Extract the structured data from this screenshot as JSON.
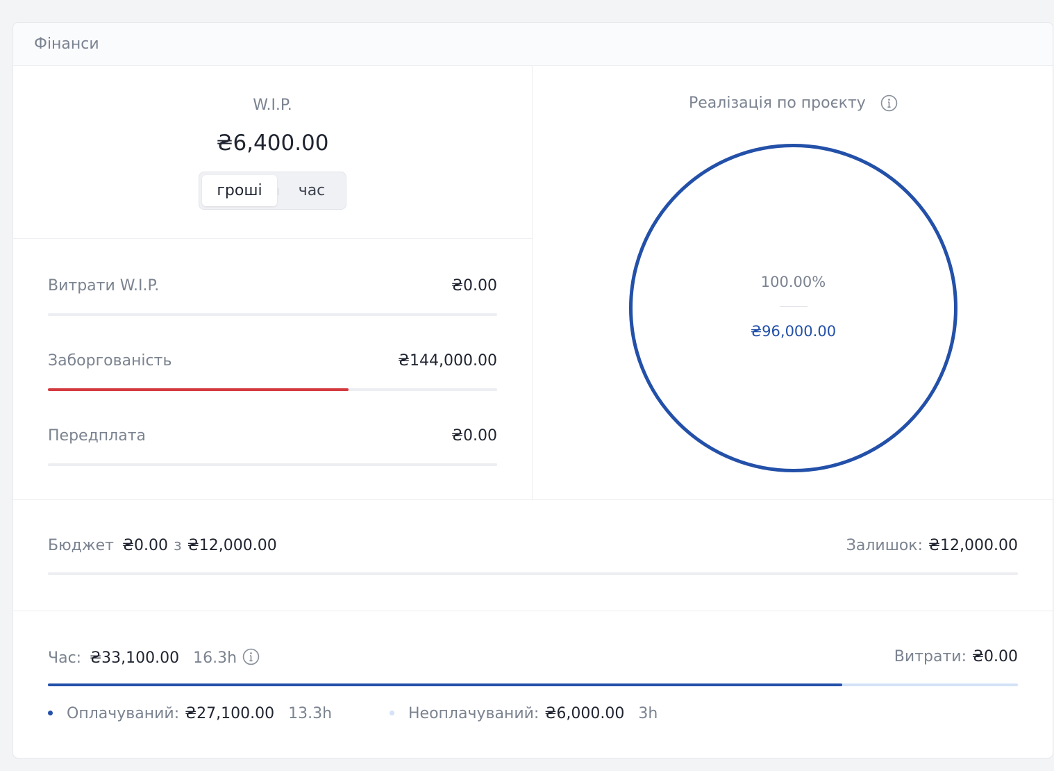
{
  "card": {
    "title": "Фінанси"
  },
  "wip": {
    "title": "W.I.P.",
    "value": "₴6,400.00",
    "toggle": {
      "money_label": "гроші",
      "time_label": "час",
      "selected": "гроші"
    }
  },
  "metrics": [
    {
      "label": "Витрати W.I.P.",
      "value": "₴0.00",
      "progress": 0,
      "color": "#d33a3f"
    },
    {
      "label": "Заборгованість",
      "value": "₴144,000.00",
      "progress": 0.67,
      "color": "#d33a3f"
    },
    {
      "label": "Передплата",
      "value": "₴0.00",
      "progress": 0,
      "color": "#d33a3f"
    }
  ],
  "realization": {
    "title": "Реалізація по проєкту",
    "info_icon": "info-icon",
    "percent": "100.00%",
    "amount": "₴96,000.00",
    "progress": 1.0,
    "color": "#2350a8"
  },
  "budget": {
    "label": "Бюджет",
    "spent": "₴0.00",
    "of": "з",
    "total": "₴12,000.00",
    "remaining_label": "Залишок:",
    "remaining_value": "₴12,000.00",
    "progress": 0
  },
  "time": {
    "label": "Час:",
    "amount": "₴33,100.00",
    "hours": "16.3h",
    "info_icon": "info-icon",
    "expenses_label": "Витрати:",
    "expenses_value": "₴0.00",
    "billable_fraction": 0.8187,
    "billable_color": "#2350a8",
    "unbillable_color": "#d3e2f7"
  },
  "legend": {
    "billable": {
      "label": "Оплачуваний:",
      "amount": "₴27,100.00",
      "hours": "13.3h"
    },
    "unbillable": {
      "label": "Неоплачуваний:",
      "amount": "₴6,000.00",
      "hours": "3h"
    }
  }
}
